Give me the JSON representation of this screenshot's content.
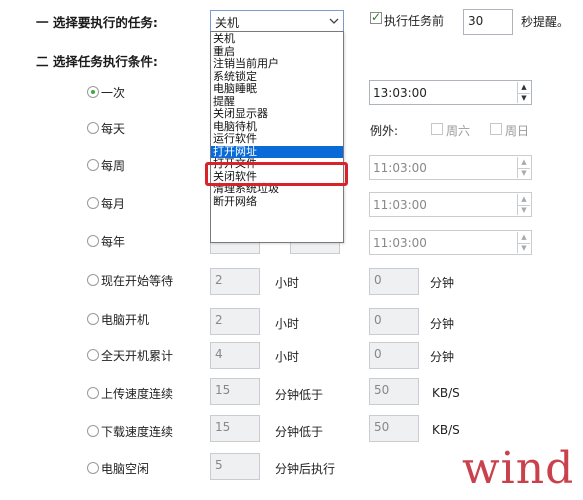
{
  "section1": {
    "title": "一 选择要执行的任务:",
    "selected_task": "关机",
    "options": [
      "关机",
      "重启",
      "注销当前用户",
      "系统锁定",
      "电脑睡眠",
      "提醒",
      "关闭显示器",
      "电脑待机",
      "运行软件",
      "打开网址",
      "打开文件",
      "关闭软件",
      "清理系统垃圾",
      "断开网络"
    ],
    "highlighted_option": "打开网址",
    "pre_exec_label": "执行任务前",
    "pre_exec_seconds": "30",
    "remind_label": "秒提醒。"
  },
  "section2": {
    "title": "二 选择任务执行条件:",
    "once_label": "一次",
    "daily_label": "每天",
    "weekly_label": "每周",
    "monthly_label": "每月",
    "yearly_label": "每年",
    "time_once": "13:03:00",
    "time_weekly": "11:03:00",
    "time_monthly": "11:03:00",
    "time_yearly": "11:03:00",
    "except_label": "例外:",
    "saturday_label": "周六",
    "sunday_label": "周日",
    "wait_label": "现在开始等待",
    "wait_hours": "2",
    "wait_minutes": "0",
    "boot_label": "电脑开机",
    "boot_hours": "2",
    "boot_minutes": "0",
    "cumulative_label": "全天开机累计",
    "cumulative_hours": "4",
    "cumulative_minutes": "0",
    "upload_label": "上传速度连续",
    "upload_minutes": "15",
    "upload_speed": "50",
    "download_label": "下载速度连续",
    "download_minutes": "15",
    "download_speed": "50",
    "idle_label": "电脑空闲",
    "idle_minutes": "5",
    "hour_unit": "小时",
    "minute_unit": "分钟",
    "minutes_below": "分钟低于",
    "speed_unit": "KB/S",
    "after_exec": "分钟后执行"
  },
  "watermark": "wind",
  "colors": {
    "select_highlight": "#0a6bd8",
    "frame_red": "#d9232a",
    "radio_on": "#3ea83e",
    "watermark": "#c9414d"
  }
}
